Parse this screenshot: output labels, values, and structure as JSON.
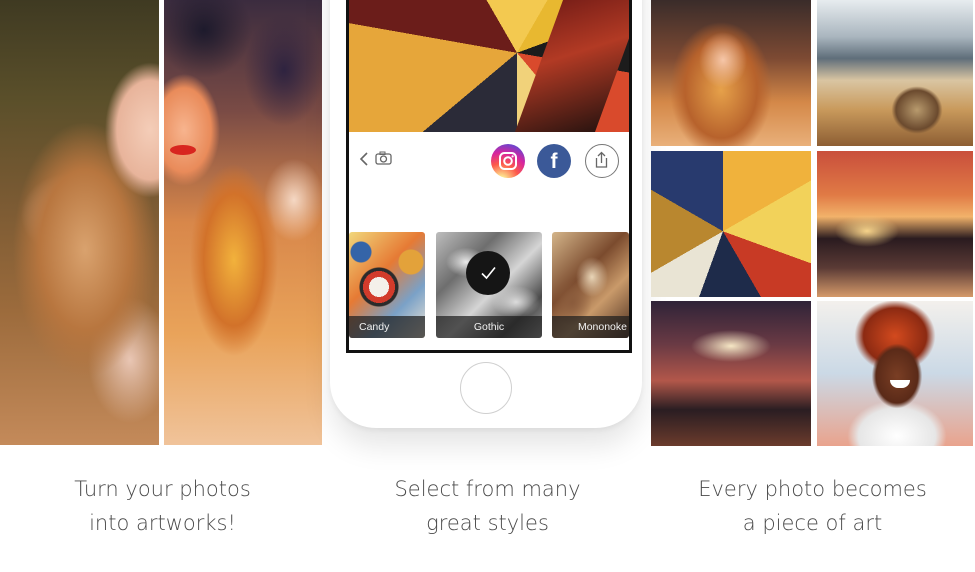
{
  "panels": [
    {
      "caption_line1": "Turn your photos",
      "caption_line2": "into artworks!"
    },
    {
      "caption_line1": "Select from many",
      "caption_line2": "great styles"
    },
    {
      "caption_line1": "Every photo becomes",
      "caption_line2": "a piece of art"
    }
  ],
  "phone": {
    "share_targets": {
      "facebook_letter": "f"
    },
    "styles": [
      {
        "label": "Candy",
        "selected": false
      },
      {
        "label": "Gothic",
        "selected": true
      },
      {
        "label": "Mononoke",
        "selected": false
      }
    ]
  },
  "icons": {
    "back": "chevron-left-icon",
    "camera": "camera-icon",
    "instagram": "instagram-icon",
    "facebook": "facebook-icon",
    "share": "share-icon",
    "check": "checkmark-icon"
  },
  "colors": {
    "facebook_blue": "#3b5998",
    "caption_text": "#4a4a4a",
    "selection_circle": "#151515"
  }
}
